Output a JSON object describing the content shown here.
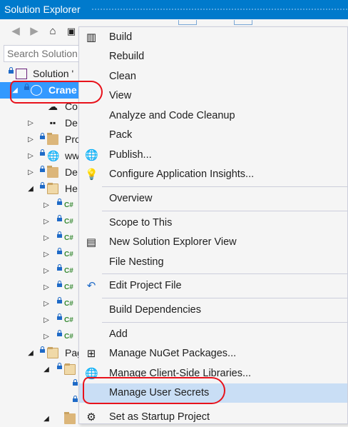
{
  "window": {
    "title": "Solution Explorer"
  },
  "search": {
    "placeholder": "Search Solution"
  },
  "tree": {
    "solution": "Solution '",
    "project": "Crane",
    "items": [
      "Co",
      "De",
      "Pro",
      "ww",
      "De",
      "He",
      "Pag"
    ]
  },
  "menu": {
    "items": [
      "Build",
      "Rebuild",
      "Clean",
      "View",
      "Analyze and Code Cleanup",
      "Pack",
      "Publish...",
      "Configure Application Insights...",
      "Overview",
      "Scope to This",
      "New Solution Explorer View",
      "File Nesting",
      "Edit Project File",
      "Build Dependencies",
      "Add",
      "Manage NuGet Packages...",
      "Manage Client-Side Libraries...",
      "Manage User Secrets",
      "Set as Startup Project"
    ]
  },
  "colors": {
    "accent": "#007acc",
    "selection": "#3399ff",
    "menu_highlight": "#c9def5",
    "annotation": "#e8121b"
  }
}
